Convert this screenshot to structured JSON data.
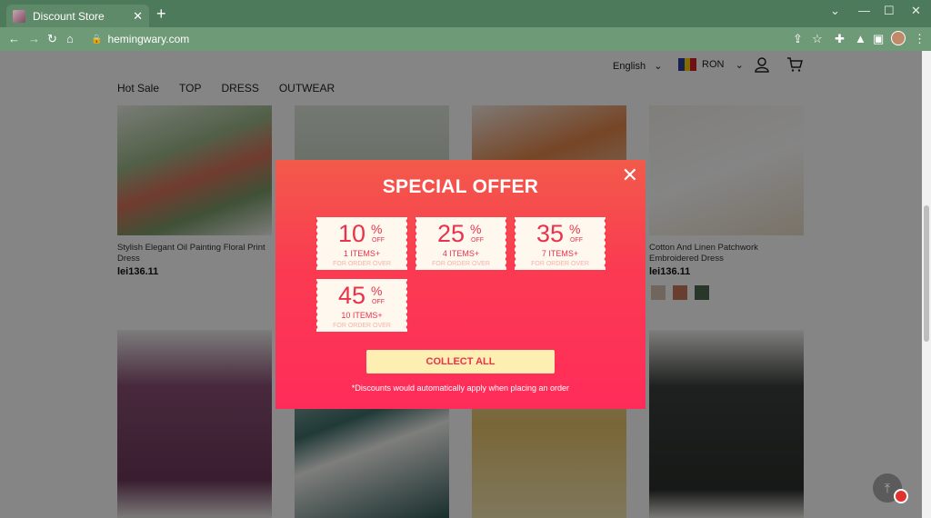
{
  "browser": {
    "tab_title": "Discount Store",
    "url": "hemingwary.com"
  },
  "header": {
    "language": "English",
    "currency": "RON",
    "nav": [
      "Hot Sale",
      "TOP",
      "DRESS",
      "OUTWEAR"
    ]
  },
  "products": [
    {
      "name": "Stylish Elegant Oil Painting Floral Print Dress",
      "price": "lei136.11"
    },
    {
      "name": "Cotton And Linen Patchwork Embroidered Dress",
      "price": "lei136.11"
    }
  ],
  "modal": {
    "title": "SPECIAL OFFER",
    "coupons": [
      {
        "percent": "10",
        "pct_symbol": "%",
        "off": "OFF",
        "items": "1 ITEMS+",
        "foot": "FOR ORDER OVER"
      },
      {
        "percent": "25",
        "pct_symbol": "%",
        "off": "OFF",
        "items": "4 ITEMS+",
        "foot": "FOR ORDER OVER"
      },
      {
        "percent": "35",
        "pct_symbol": "%",
        "off": "OFF",
        "items": "7 ITEMS+",
        "foot": "FOR ORDER OVER"
      },
      {
        "percent": "45",
        "pct_symbol": "%",
        "off": "OFF",
        "items": "10 ITEMS+",
        "foot": "FOR ORDER OVER"
      }
    ],
    "collect_label": "COLLECT ALL",
    "note": "*Discounts would automatically apply when placing an order"
  },
  "colors": {
    "chrome": "#4d7a5a",
    "modal_top": "#f25a4a",
    "modal_bottom": "#ff2c5a",
    "collect_bg": "#fdeeb2",
    "accent": "#e8334a"
  }
}
